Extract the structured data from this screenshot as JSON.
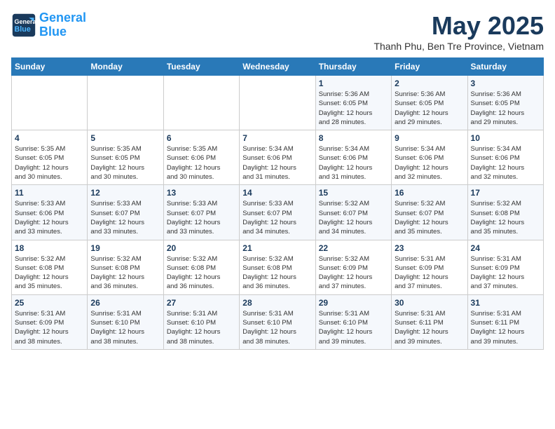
{
  "header": {
    "logo_line1": "General",
    "logo_line2": "Blue",
    "month": "May 2025",
    "location": "Thanh Phu, Ben Tre Province, Vietnam"
  },
  "weekdays": [
    "Sunday",
    "Monday",
    "Tuesday",
    "Wednesday",
    "Thursday",
    "Friday",
    "Saturday"
  ],
  "weeks": [
    [
      {
        "day": "",
        "info": ""
      },
      {
        "day": "",
        "info": ""
      },
      {
        "day": "",
        "info": ""
      },
      {
        "day": "",
        "info": ""
      },
      {
        "day": "1",
        "info": "Sunrise: 5:36 AM\nSunset: 6:05 PM\nDaylight: 12 hours\nand 28 minutes."
      },
      {
        "day": "2",
        "info": "Sunrise: 5:36 AM\nSunset: 6:05 PM\nDaylight: 12 hours\nand 29 minutes."
      },
      {
        "day": "3",
        "info": "Sunrise: 5:36 AM\nSunset: 6:05 PM\nDaylight: 12 hours\nand 29 minutes."
      }
    ],
    [
      {
        "day": "4",
        "info": "Sunrise: 5:35 AM\nSunset: 6:05 PM\nDaylight: 12 hours\nand 30 minutes."
      },
      {
        "day": "5",
        "info": "Sunrise: 5:35 AM\nSunset: 6:05 PM\nDaylight: 12 hours\nand 30 minutes."
      },
      {
        "day": "6",
        "info": "Sunrise: 5:35 AM\nSunset: 6:06 PM\nDaylight: 12 hours\nand 30 minutes."
      },
      {
        "day": "7",
        "info": "Sunrise: 5:34 AM\nSunset: 6:06 PM\nDaylight: 12 hours\nand 31 minutes."
      },
      {
        "day": "8",
        "info": "Sunrise: 5:34 AM\nSunset: 6:06 PM\nDaylight: 12 hours\nand 31 minutes."
      },
      {
        "day": "9",
        "info": "Sunrise: 5:34 AM\nSunset: 6:06 PM\nDaylight: 12 hours\nand 32 minutes."
      },
      {
        "day": "10",
        "info": "Sunrise: 5:34 AM\nSunset: 6:06 PM\nDaylight: 12 hours\nand 32 minutes."
      }
    ],
    [
      {
        "day": "11",
        "info": "Sunrise: 5:33 AM\nSunset: 6:06 PM\nDaylight: 12 hours\nand 33 minutes."
      },
      {
        "day": "12",
        "info": "Sunrise: 5:33 AM\nSunset: 6:07 PM\nDaylight: 12 hours\nand 33 minutes."
      },
      {
        "day": "13",
        "info": "Sunrise: 5:33 AM\nSunset: 6:07 PM\nDaylight: 12 hours\nand 33 minutes."
      },
      {
        "day": "14",
        "info": "Sunrise: 5:33 AM\nSunset: 6:07 PM\nDaylight: 12 hours\nand 34 minutes."
      },
      {
        "day": "15",
        "info": "Sunrise: 5:32 AM\nSunset: 6:07 PM\nDaylight: 12 hours\nand 34 minutes."
      },
      {
        "day": "16",
        "info": "Sunrise: 5:32 AM\nSunset: 6:07 PM\nDaylight: 12 hours\nand 35 minutes."
      },
      {
        "day": "17",
        "info": "Sunrise: 5:32 AM\nSunset: 6:08 PM\nDaylight: 12 hours\nand 35 minutes."
      }
    ],
    [
      {
        "day": "18",
        "info": "Sunrise: 5:32 AM\nSunset: 6:08 PM\nDaylight: 12 hours\nand 35 minutes."
      },
      {
        "day": "19",
        "info": "Sunrise: 5:32 AM\nSunset: 6:08 PM\nDaylight: 12 hours\nand 36 minutes."
      },
      {
        "day": "20",
        "info": "Sunrise: 5:32 AM\nSunset: 6:08 PM\nDaylight: 12 hours\nand 36 minutes."
      },
      {
        "day": "21",
        "info": "Sunrise: 5:32 AM\nSunset: 6:08 PM\nDaylight: 12 hours\nand 36 minutes."
      },
      {
        "day": "22",
        "info": "Sunrise: 5:32 AM\nSunset: 6:09 PM\nDaylight: 12 hours\nand 37 minutes."
      },
      {
        "day": "23",
        "info": "Sunrise: 5:31 AM\nSunset: 6:09 PM\nDaylight: 12 hours\nand 37 minutes."
      },
      {
        "day": "24",
        "info": "Sunrise: 5:31 AM\nSunset: 6:09 PM\nDaylight: 12 hours\nand 37 minutes."
      }
    ],
    [
      {
        "day": "25",
        "info": "Sunrise: 5:31 AM\nSunset: 6:09 PM\nDaylight: 12 hours\nand 38 minutes."
      },
      {
        "day": "26",
        "info": "Sunrise: 5:31 AM\nSunset: 6:10 PM\nDaylight: 12 hours\nand 38 minutes."
      },
      {
        "day": "27",
        "info": "Sunrise: 5:31 AM\nSunset: 6:10 PM\nDaylight: 12 hours\nand 38 minutes."
      },
      {
        "day": "28",
        "info": "Sunrise: 5:31 AM\nSunset: 6:10 PM\nDaylight: 12 hours\nand 38 minutes."
      },
      {
        "day": "29",
        "info": "Sunrise: 5:31 AM\nSunset: 6:10 PM\nDaylight: 12 hours\nand 39 minutes."
      },
      {
        "day": "30",
        "info": "Sunrise: 5:31 AM\nSunset: 6:11 PM\nDaylight: 12 hours\nand 39 minutes."
      },
      {
        "day": "31",
        "info": "Sunrise: 5:31 AM\nSunset: 6:11 PM\nDaylight: 12 hours\nand 39 minutes."
      }
    ]
  ]
}
